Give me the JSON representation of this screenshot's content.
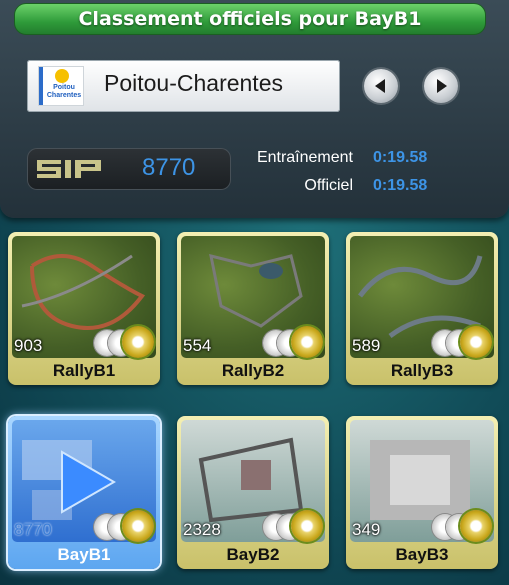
{
  "header": {
    "title": "Classement officiels pour BayB1"
  },
  "region": {
    "name": "Poitou-Charentes",
    "logo_line1": "Poitou",
    "logo_line2": "Charentes"
  },
  "nav": {
    "prev_icon": "arrow-left-icon",
    "next_icon": "arrow-right-icon"
  },
  "stats": {
    "sp_value": "8770",
    "training_label": "Entraînement",
    "training_time": "0:19.58",
    "official_label": "Officiel",
    "official_time": "0:19.58"
  },
  "tracks": [
    {
      "name": "RallyB1",
      "count": "903",
      "selected": false
    },
    {
      "name": "RallyB2",
      "count": "554",
      "selected": false
    },
    {
      "name": "RallyB3",
      "count": "589",
      "selected": false
    },
    {
      "name": "BayB1",
      "count": "8770",
      "selected": true
    },
    {
      "name": "BayB2",
      "count": "2328",
      "selected": false
    },
    {
      "name": "BayB3",
      "count": "349",
      "selected": false
    }
  ],
  "colors": {
    "accent_blue": "#3d94e6",
    "title_green": "#2f9b3a",
    "tile_gold": "#e9d36a"
  }
}
